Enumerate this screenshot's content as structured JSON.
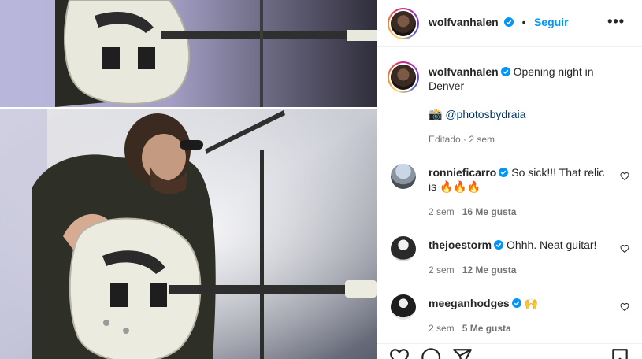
{
  "post": {
    "author": "wolfvanhalen",
    "follow_label": "Seguir",
    "dot": "•",
    "more_label": "•••",
    "caption": "Opening night in Denver",
    "credit_emoji": "📸",
    "credit_handle": "@photosbydraia",
    "edited": "Editado · 2 sem"
  },
  "comments": [
    {
      "user": "ronnieficarro",
      "text": "So sick!!! That relic is 🔥🔥🔥",
      "age": "2 sem",
      "likes": "16 Me gusta"
    },
    {
      "user": "thejoestorm",
      "text": "Ohhh. Neat guitar!",
      "age": "2 sem",
      "likes": "12 Me gusta"
    },
    {
      "user": "meeganhodges",
      "text": "🙌",
      "age": "2 sem",
      "likes": "5 Me gusta"
    }
  ],
  "icons": {
    "verified": "verified-badge-icon",
    "like": "heart-icon",
    "comment": "comment-icon",
    "share": "share-icon",
    "save": "bookmark-icon",
    "more": "more-options-icon"
  },
  "colors": {
    "link": "#0095f6",
    "verified": "#0095f6",
    "text": "#262626",
    "muted": "#737373"
  }
}
